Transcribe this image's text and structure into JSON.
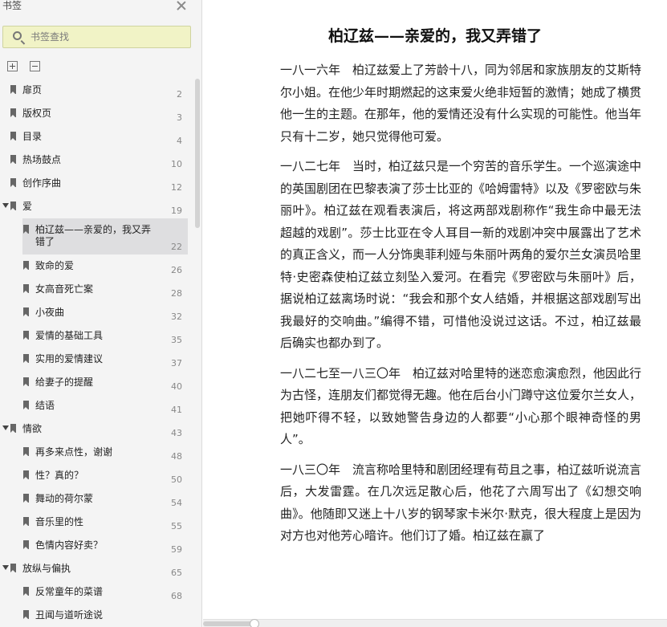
{
  "sidebar": {
    "title": "书签",
    "search_placeholder": "书签查找",
    "bookmarks": [
      {
        "label": "扉页",
        "page": "2",
        "level": 1,
        "kind": "item",
        "selected": false
      },
      {
        "label": "版权页",
        "page": "3",
        "level": 1,
        "kind": "item",
        "selected": false
      },
      {
        "label": "目录",
        "page": "4",
        "level": 1,
        "kind": "item",
        "selected": false
      },
      {
        "label": "热场鼓点",
        "page": "10",
        "level": 1,
        "kind": "item",
        "selected": false
      },
      {
        "label": "创作序曲",
        "page": "12",
        "level": 1,
        "kind": "item",
        "selected": false
      },
      {
        "label": "爱",
        "page": "19",
        "level": 1,
        "kind": "group",
        "selected": false
      },
      {
        "label": "柏辽兹——亲爱的，我又弄错了",
        "page": "22",
        "level": 2,
        "kind": "item",
        "selected": true
      },
      {
        "label": "致命的爱",
        "page": "26",
        "level": 2,
        "kind": "item",
        "selected": false
      },
      {
        "label": "女高音死亡案",
        "page": "28",
        "level": 2,
        "kind": "item",
        "selected": false
      },
      {
        "label": "小夜曲",
        "page": "32",
        "level": 2,
        "kind": "item",
        "selected": false
      },
      {
        "label": "爱情的基础工具",
        "page": "35",
        "level": 2,
        "kind": "item",
        "selected": false
      },
      {
        "label": "实用的爱情建议",
        "page": "37",
        "level": 2,
        "kind": "item",
        "selected": false
      },
      {
        "label": "给妻子的提醒",
        "page": "40",
        "level": 2,
        "kind": "item",
        "selected": false
      },
      {
        "label": "结语",
        "page": "41",
        "level": 2,
        "kind": "item",
        "selected": false
      },
      {
        "label": "情欲",
        "page": "43",
        "level": 1,
        "kind": "group",
        "selected": false
      },
      {
        "label": "再多来点性，谢谢",
        "page": "48",
        "level": 2,
        "kind": "item",
        "selected": false
      },
      {
        "label": "性？真的？",
        "page": "50",
        "level": 2,
        "kind": "item",
        "selected": false
      },
      {
        "label": "舞动的荷尔蒙",
        "page": "54",
        "level": 2,
        "kind": "item",
        "selected": false
      },
      {
        "label": "音乐里的性",
        "page": "55",
        "level": 2,
        "kind": "item",
        "selected": false
      },
      {
        "label": "色情内容好卖？",
        "page": "59",
        "level": 2,
        "kind": "item",
        "selected": false
      },
      {
        "label": "放纵与偏执",
        "page": "65",
        "level": 1,
        "kind": "group",
        "selected": false
      },
      {
        "label": "反常童年的菜谱",
        "page": "68",
        "level": 2,
        "kind": "item",
        "selected": false
      },
      {
        "label": "丑闻与道听途说",
        "page": "",
        "level": 2,
        "kind": "item",
        "selected": false
      }
    ],
    "icons": {
      "close": "close-icon",
      "search": "search-icon",
      "expand_all": "expand-all-icon",
      "collapse_all": "collapse-all-icon",
      "bookmark": "bookmark-flag-icon",
      "group_toggle": "caret-down-icon"
    },
    "search_highlight_color": "#f1f3c6",
    "selected_row_color": "#dedee0"
  },
  "document": {
    "title": "柏辽兹——亲爱的，我又弄错了",
    "paragraphs": [
      "一八一六年　柏辽兹爱上了芳龄十八，同为邻居和家族朋友的艾斯特尔小姐。在他少年时期燃起的这束爱火绝非短暂的激情；她成了横贯他一生的主题。在那年，他的爱情还没有什么实现的可能性。他当年只有十二岁，她只觉得他可爱。",
      "一八二七年　当时，柏辽兹只是一个穷苦的音乐学生。一个巡演途中的英国剧团在巴黎表演了莎士比亚的《哈姆雷特》以及《罗密欧与朱丽叶》。柏辽兹在观看表演后，将这两部戏剧称作“我生命中最无法超越的戏剧”。莎士比亚在令人耳目一新的戏剧冲突中展露出了艺术的真正含义，而一人分饰奥菲利娅与朱丽叶两角的爱尔兰女演员哈里特·史密森使柏辽兹立刻坠入爱河。在看完《罗密欧与朱丽叶》后，据说柏辽兹离场时说：“我会和那个女人结婚，并根据这部戏剧写出我最好的交响曲。”编得不错，可惜他没说过这话。不过，柏辽兹最后确实也都办到了。",
      "一八二七至一八三〇年　柏辽兹对哈里特的迷恋愈演愈烈，他因此行为古怪，连朋友们都觉得无趣。他在后台小门蹲守这位爱尔兰女人，把她吓得不轻，以致她警告身边的人都要“小心那个眼神奇怪的男人”。",
      "一八三〇年　流言称哈里特和剧团经理有苟且之事，柏辽兹听说流言后，大发雷霆。在几次远足散心后，他花了六周写出了《幻想交响曲》。他随即又迷上十八岁的钢琴家卡米尔·默克，很大程度上是因为对方也对他芳心暗许。他们订了婚。柏辽兹在赢了"
    ]
  }
}
